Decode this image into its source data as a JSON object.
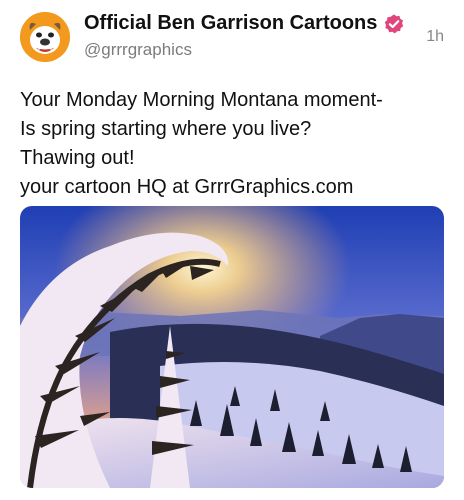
{
  "post": {
    "author_name": "Official  Ben Garrison Cartoons",
    "handle": "@grrrgraphics",
    "time": "1h",
    "lines": [
      "Your Monday Morning Montana moment-",
      "Is spring starting where you live?",
      "Thawing out!",
      "your cartoon HQ at GrrrGraphics.com"
    ],
    "avatar_icon": "bulldog-avatar-icon",
    "verified_icon": "verified-badge-icon",
    "colors": {
      "avatar_bg": "#f39a1e",
      "verified": "#e0457b",
      "handle": "#7c7c7c"
    }
  }
}
